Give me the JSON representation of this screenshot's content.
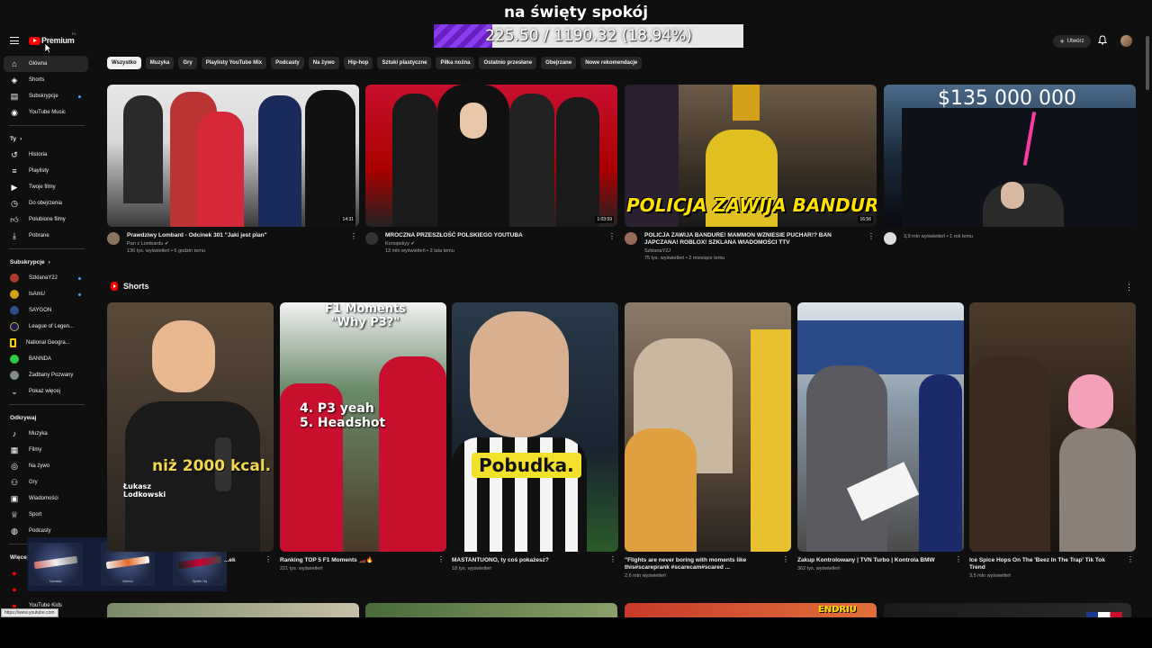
{
  "overlay": {
    "title": "na święty spokój",
    "progress_text": "225.50 / 1190.32 (18.94%)",
    "progress_fraction": 0.1894
  },
  "header": {
    "logo_text": "Premium",
    "logo_sup": "PL",
    "create_label": "Utwórz"
  },
  "sidebar": {
    "main": [
      {
        "label": "Główna",
        "icon": "home-icon"
      },
      {
        "label": "Shorts",
        "icon": "shorts-icon"
      },
      {
        "label": "Subskrypcje",
        "icon": "subscriptions-icon"
      },
      {
        "label": "YouTube Music",
        "icon": "music-icon"
      }
    ],
    "you_head": "Ty",
    "you": [
      {
        "label": "Historia",
        "icon": "history-icon"
      },
      {
        "label": "Playlisty",
        "icon": "playlist-icon"
      },
      {
        "label": "Twoje filmy",
        "icon": "your-videos-icon"
      },
      {
        "label": "Do obejrzenia",
        "icon": "watch-later-icon"
      },
      {
        "label": "Polubione filmy",
        "icon": "liked-icon"
      },
      {
        "label": "Pobrane",
        "icon": "download-icon"
      }
    ],
    "subs_head": "Subskrypcje",
    "subs": [
      {
        "label": "SzklanaY2J",
        "color": "#b03a2e"
      },
      {
        "label": "IsAmU",
        "color": "#d4a017"
      },
      {
        "label": "SAYGON",
        "color": "#2a4d8f"
      },
      {
        "label": "League of Legen...",
        "color": "#1a1a4e"
      },
      {
        "label": "National Geogra...",
        "color": "#ffcc00"
      },
      {
        "label": "BANNDA",
        "color": "#2ecc40"
      },
      {
        "label": "Zadbany Pozwany",
        "color": "#7f8c8d"
      }
    ],
    "show_more": "Pokaż więcej",
    "explore_head": "Odkrywaj",
    "explore": [
      {
        "label": "Muzyka",
        "icon": "music-note-icon"
      },
      {
        "label": "Filmy",
        "icon": "film-icon"
      },
      {
        "label": "Na żywo",
        "icon": "live-icon"
      },
      {
        "label": "Gry",
        "icon": "gaming-icon"
      },
      {
        "label": "Wiadomości",
        "icon": "news-icon"
      },
      {
        "label": "Sport",
        "icon": "trophy-icon"
      },
      {
        "label": "Podcasty",
        "icon": "podcast-icon"
      }
    ],
    "more_head": "Więcej z YouTube",
    "kids": "YouTube Kids",
    "url_tip": "https://www.youtube.com"
  },
  "chips": [
    "Wszystko",
    "Muzyka",
    "Gry",
    "Playlisty YouTube Mix",
    "Podcasty",
    "Na żywo",
    "Hip-hop",
    "Sztuki plastyczne",
    "Piłka nożna",
    "Ostatnio przesłane",
    "Obejrzane",
    "Nowe rekomendacje"
  ],
  "videos": [
    {
      "title": "Prawdziwy Lombard - Odcinek 301 \"Jaki jest plan\"",
      "channel": "Pan z Lombardu ✔",
      "stats": "136 tys. wyświetleń • 6 godzin temu",
      "duration": "14:31"
    },
    {
      "title": "MROCZNA PRZESZŁOŚĆ POLSKIEGO YOUTUBA",
      "channel": "Konopskyy ✔",
      "stats": "13 mln wyświetleń • 2 lata temu",
      "duration": "1:03:59"
    },
    {
      "title": "POLICJA ZAWIJA BANDURE! MAMMON WZNIESIE PUCHAR!? BAN JAPCZANA! ROBLOX! SZKLANA WIADOMOŚCI TTV",
      "channel": "SzklanaY2J",
      "stats": "75 tys. wyświetleń • 2 miesiące temu",
      "duration": "16:56",
      "overlay": "POLICJA ZAWIJA BANDURE!"
    },
    {
      "title": "",
      "channel": "",
      "stats": "3,9 mln wyświetleń • 1 rok temu",
      "duration": "",
      "overlay": "$135 000 000"
    }
  ],
  "shorts_label": "Shorts",
  "shorts": [
    {
      "title": "...ek",
      "stats": "",
      "overlay": "niż 2000 kcal.",
      "name_tag": "Łukasz Lodkowski"
    },
    {
      "title": "Ranking TOP 5 F1 Moments 🏎️🔥",
      "stats": "221 tys. wyświetleń",
      "overlay": "F1 Moments \"Why P3?\"",
      "overlay2": "4. P3 yeah\n5. Headshot"
    },
    {
      "title": "MASTANTUONO, ty coś pokażesz?",
      "stats": "18 tys. wyświetleń",
      "overlay": "Pobudka."
    },
    {
      "title": "\"Flights are never boring with moments like this#scareprank #scarecam#scared ...",
      "stats": "2,6 mln wyświetleń",
      "overlay": ""
    },
    {
      "title": "Zakup Kontrolowany | TVN Turbo | Kontrola BMW",
      "stats": "362 tys. wyświetleń",
      "overlay": ""
    },
    {
      "title": "Ice Spice Hops On The 'Beez In The Trap' Tik Tok Trend",
      "stats": "3,5 mln wyświetleń",
      "overlay": ""
    }
  ],
  "bottom_overlay": "ENDRIU",
  "skins": [
    "Nomadic",
    "Azimov",
    "Spider Lily"
  ],
  "colors": {
    "accent": "#ff0000",
    "bg": "#0f0f0f",
    "chip": "#272727",
    "progress": "#7a2ee0"
  }
}
